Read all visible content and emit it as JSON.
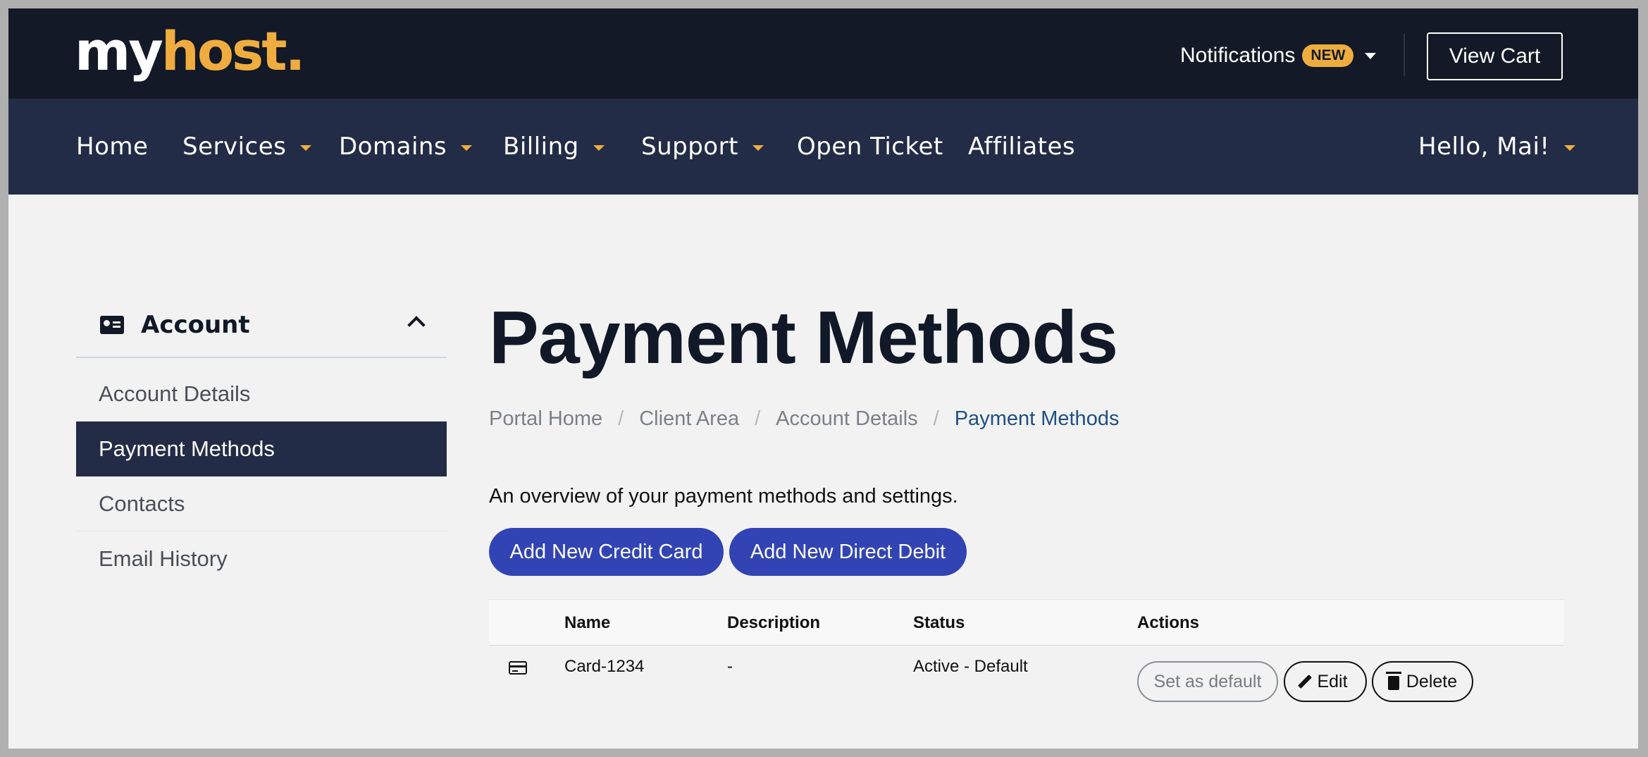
{
  "brand": {
    "part1": "my",
    "part2": "host."
  },
  "topbar": {
    "notifications_label": "Notifications",
    "notifications_badge": "NEW",
    "view_cart_label": "View Cart"
  },
  "nav": {
    "items": [
      {
        "label": "Home",
        "has_dropdown": false
      },
      {
        "label": "Services",
        "has_dropdown": true
      },
      {
        "label": "Domains",
        "has_dropdown": true
      },
      {
        "label": "Billing",
        "has_dropdown": true
      },
      {
        "label": "Support",
        "has_dropdown": true
      },
      {
        "label": "Open Ticket",
        "has_dropdown": false
      },
      {
        "label": "Affiliates",
        "has_dropdown": false
      }
    ],
    "user_greeting": "Hello, Mai!"
  },
  "sidebar": {
    "header": "Account",
    "items": [
      {
        "label": "Account Details",
        "active": false
      },
      {
        "label": "Payment Methods",
        "active": true
      },
      {
        "label": "Contacts",
        "active": false
      },
      {
        "label": "Email History",
        "active": false
      }
    ]
  },
  "main": {
    "title": "Payment Methods",
    "breadcrumb": [
      "Portal Home",
      "Client Area",
      "Account Details",
      "Payment Methods"
    ],
    "overview": "An overview of your payment methods and settings.",
    "add_credit_card_label": "Add New Credit Card",
    "add_direct_debit_label": "Add New Direct Debit",
    "table": {
      "headers": {
        "name": "Name",
        "description": "Description",
        "status": "Status",
        "actions": "Actions"
      },
      "rows": [
        {
          "icon": "credit-card-icon",
          "name": "Card-1234",
          "description": "-",
          "status": "Active - Default",
          "set_default_label": "Set as default",
          "edit_label": "Edit",
          "delete_label": "Delete"
        }
      ]
    }
  },
  "colors": {
    "topbar_bg": "#131926",
    "nav_bg": "#232c46",
    "accent": "#f0ad3f",
    "primary_button": "#3244b3",
    "breadcrumb_active": "#1f4f83"
  }
}
